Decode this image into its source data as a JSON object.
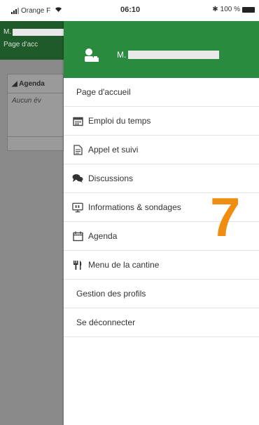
{
  "status_bar": {
    "carrier": "Orange F",
    "time": "06:10",
    "battery": "100 %"
  },
  "background_app": {
    "user_initial": "M.",
    "page_title": "Page d'acc",
    "panel_title": "Agenda",
    "panel_text": "Aucun év"
  },
  "drawer": {
    "user_initial": "M.",
    "menu": [
      {
        "label": "Page d'accueil",
        "icon": "none"
      },
      {
        "label": "Emploi du temps",
        "icon": "calendar-icon"
      },
      {
        "label": "Appel et suivi",
        "icon": "document-icon"
      },
      {
        "label": "Discussions",
        "icon": "chat-bubbles-icon"
      },
      {
        "label": "Informations & sondages",
        "icon": "info-board-icon"
      },
      {
        "label": "Agenda",
        "icon": "calendar-icon"
      },
      {
        "label": "Menu de la cantine",
        "icon": "fork-knife-icon"
      },
      {
        "label": "Gestion des profils",
        "icon": "none"
      },
      {
        "label": "Se déconnecter",
        "icon": "none"
      }
    ]
  },
  "annotation": {
    "number": "7",
    "color": "#f08c10"
  },
  "colors": {
    "header_green": "#2a8a3e",
    "dim_overlay": "#8a8a8a"
  }
}
